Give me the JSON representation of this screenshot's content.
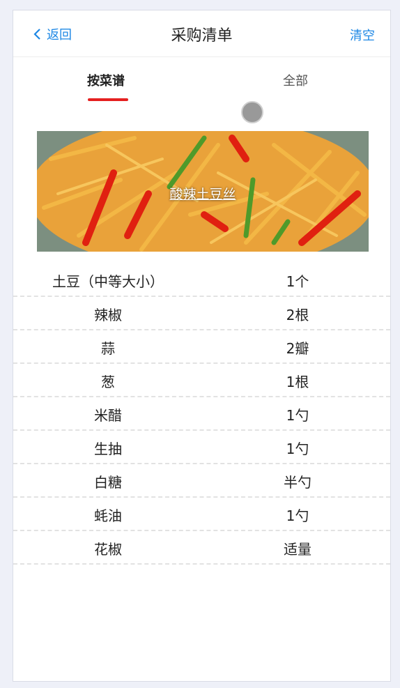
{
  "nav": {
    "back_label": "返回",
    "title": "采购清单",
    "clear_label": "清空"
  },
  "tabs": [
    {
      "label": "按菜谱",
      "active": true
    },
    {
      "label": "全部",
      "active": false
    }
  ],
  "recipe": {
    "title": "酸辣土豆丝",
    "ingredients": [
      {
        "name": "土豆（中等大小）",
        "qty": "1个"
      },
      {
        "name": "辣椒",
        "qty": "2根"
      },
      {
        "name": "蒜",
        "qty": "2瓣"
      },
      {
        "name": "葱",
        "qty": "1根"
      },
      {
        "name": "米醋",
        "qty": "1勺"
      },
      {
        "name": "生抽",
        "qty": "1勺"
      },
      {
        "name": "白糖",
        "qty": "半勺"
      },
      {
        "name": "蚝油",
        "qty": "1勺"
      },
      {
        "name": "花椒",
        "qty": "适量"
      }
    ]
  },
  "colors": {
    "accent": "#1e88e5",
    "tab_indicator": "#e52020"
  }
}
